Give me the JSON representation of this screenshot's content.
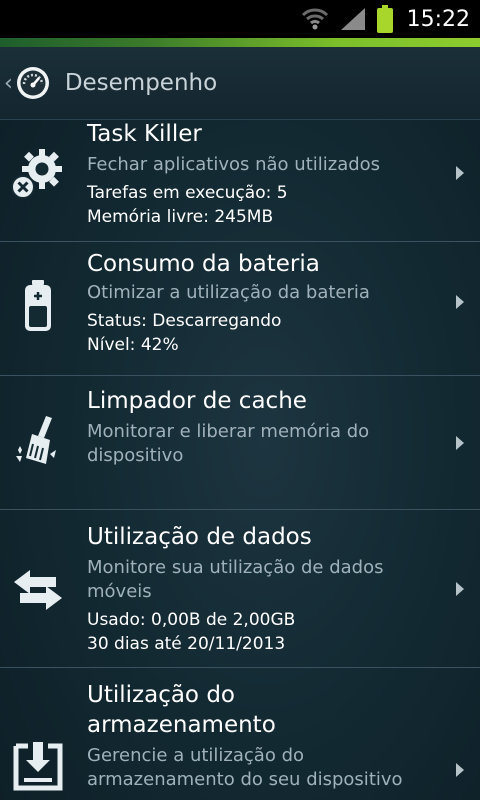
{
  "status_bar": {
    "time": "15:22",
    "icons": [
      "wifi-icon",
      "signal-icon",
      "battery-icon"
    ]
  },
  "header": {
    "title": "Desempenho",
    "back_icon": "chevron-left-icon",
    "app_icon": "speedometer-icon"
  },
  "items": [
    {
      "icon": "gear-close-icon",
      "title": "Task Killer",
      "subtitle": "Fechar aplicativos não utilizados",
      "details": [
        "Tarefas em execução: 5",
        "Memória livre: 245MB"
      ]
    },
    {
      "icon": "battery-icon",
      "title": "Consumo da bateria",
      "subtitle": "Otimizar a utilização da bateria",
      "details": [
        "Status: Descarregando",
        "Nível: 42%"
      ]
    },
    {
      "icon": "broom-icon",
      "title": "Limpador de cache",
      "subtitle_lines": [
        "Monitorar e liberar memória do",
        "dispositivo"
      ]
    },
    {
      "icon": "transfer-arrows-icon",
      "title": "Utilização de dados",
      "subtitle_lines": [
        "Monitore sua utilização de dados",
        "móveis"
      ],
      "details": [
        "Usado: 0,00B de 2,00GB",
        "30 dias até 20/11/2013"
      ]
    },
    {
      "icon": "storage-download-icon",
      "title_lines": [
        "Utilização do",
        "armazenamento"
      ],
      "subtitle_lines": [
        "Gerencie a utilização do",
        "armazenamento do seu dispositivo"
      ]
    }
  ],
  "colors": {
    "accent": "#8dcc2e",
    "background": "#132a33",
    "subtitle": "#9fb1ba"
  }
}
